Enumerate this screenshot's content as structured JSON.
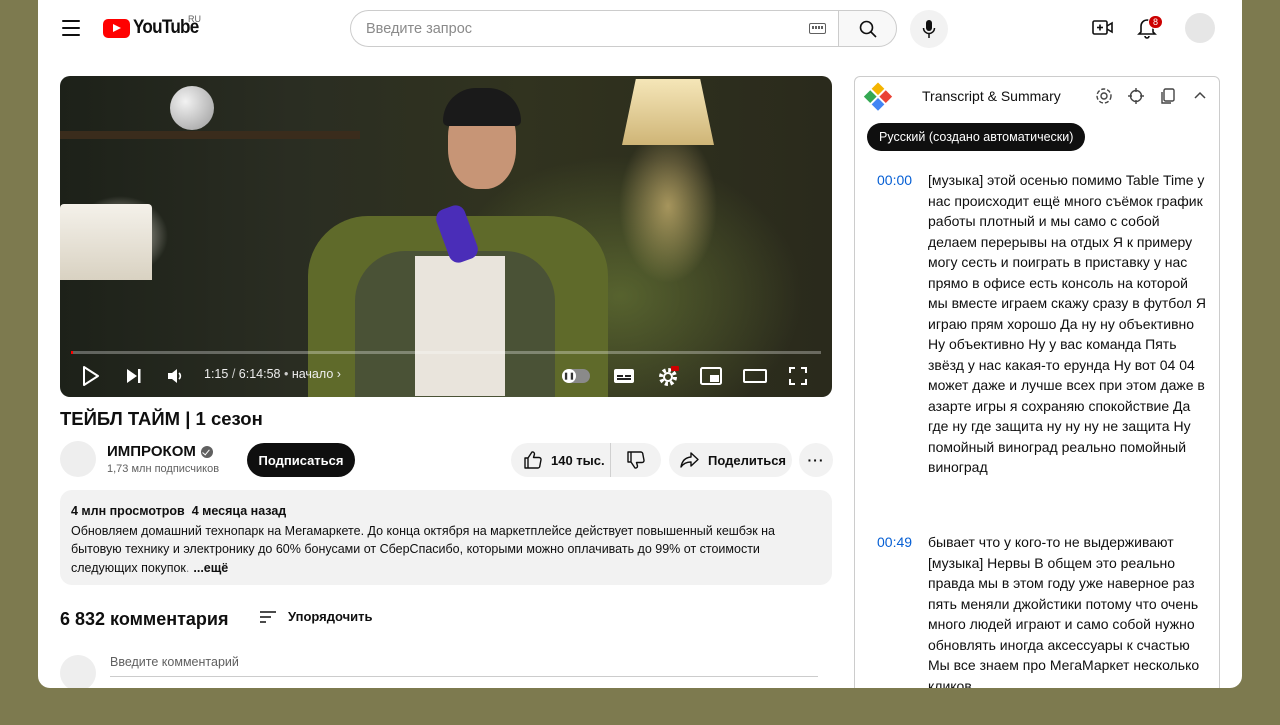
{
  "header": {
    "logo_text": "YouTube",
    "region": "RU",
    "search_placeholder": "Введите запрос",
    "notification_count": "8"
  },
  "player": {
    "current_time": "1:15",
    "duration": "6:14:58",
    "chapter": "начало",
    "progress_fraction": 0.0033
  },
  "video": {
    "title": "ТЕЙБЛ ТАЙМ | 1 сезон",
    "channel_name": "ИМПРОКОМ",
    "subscribers": "1,73 млн подписчиков",
    "subscribe_label": "Подписаться",
    "likes": "140 тыс.",
    "share_label": "Поделиться"
  },
  "description": {
    "views": "4 млн просмотров",
    "age": "4 месяца назад",
    "text": "Обновляем домашний технопарк на Мегамаркете. До конца октября на маркетплейсе действует повышенный кешбэк на бытовую технику и электронику до 60% бонусами от СберСпасибо, которыми можно оплачивать до 99% от стоимости следующих покупок",
    "fade_char": ".",
    "more_label": "...ещё"
  },
  "comments": {
    "count_label": "6 832 комментария",
    "sort_label": "Упорядочить",
    "input_placeholder": "Введите комментарий"
  },
  "transcript": {
    "title": "Transcript & Summary",
    "language_chip": "Русский (создано автоматически)",
    "segments": [
      {
        "time": "00:00",
        "text": "[музыка] этой осенью помимо Table Time у нас происходит ещё много съёмок график работы плотный и мы само с собой делаем перерывы на отдых Я к примеру могу сесть и поиграть в приставку у нас прямо в офисе есть консоль на которой мы вместе играем скажу сразу в футбол Я играю прям хорошо Да ну ну объективно Ну объективно Ну у вас команда Пять звёзд у нас какая-то ерунда Ну вот 04 04 может даже и лучше всех при этом даже в азарте игры я сохраняю спокойствие Да где ну где защита ну ну ну не защита Ну помойный виноград реально помойный виноград"
      },
      {
        "time": "00:49",
        "text": "бывает что у кого-то не выдерживают [музыка] Нервы В общем это реально правда мы в этом году уже наверное раз пять меняли джойстики потому что очень много людей играют и само собой нужно обновлять иногда аксессуары к счастью Мы все знаем про МегаМаркет несколько кликов"
      }
    ]
  },
  "colors": {
    "brand_red": "#ff0000",
    "link_blue": "#065fd4",
    "background": "#7d7a4f"
  },
  "icons": [
    "menu-icon",
    "keyboard-icon",
    "search-icon",
    "mic-icon",
    "create-video-icon",
    "bell-icon",
    "play-icon",
    "next-icon",
    "volume-icon",
    "autoplay-toggle",
    "subtitles-icon",
    "settings-icon",
    "miniplayer-icon",
    "theater-icon",
    "fullscreen-icon",
    "like-icon",
    "dislike-icon",
    "share-icon",
    "sort-icon",
    "openai-icon",
    "target-icon",
    "copy-icon",
    "chevron-up-icon"
  ]
}
